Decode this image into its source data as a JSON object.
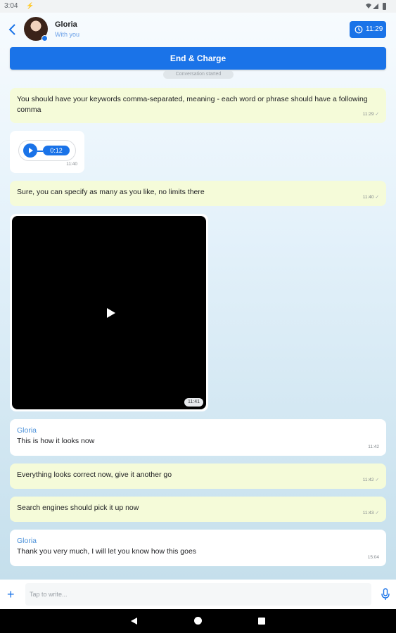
{
  "status_bar": {
    "time": "3:04",
    "bolt_icon": "⚡",
    "icons": [
      "wifi-icon",
      "signal-icon",
      "battery-icon"
    ]
  },
  "header": {
    "contact_name": "Gloria",
    "contact_subtitle": "With you",
    "timer": "11:29"
  },
  "end_button_label": "End & Charge",
  "conversation_started": "Conversation started",
  "messages": [
    {
      "type": "outgoing",
      "text": "You should have your keywords comma-separated, meaning - each word or phrase should have a following comma",
      "time": "11:29",
      "check": "✓"
    },
    {
      "type": "voice",
      "duration": "0:12",
      "time": "11:40"
    },
    {
      "type": "outgoing",
      "text": "Sure, you can specify as many as you like, no limits there",
      "time": "11:40",
      "check": "✓"
    },
    {
      "type": "video",
      "time": "11:41"
    },
    {
      "type": "incoming",
      "sender": "Gloria",
      "text": "This is how it looks now",
      "time": "11:42"
    },
    {
      "type": "outgoing",
      "text": "Everything looks correct now, give it another go",
      "time": "11:42",
      "check": "✓"
    },
    {
      "type": "outgoing",
      "text": "Search engines should pick it up now",
      "time": "11:43",
      "check": "✓"
    },
    {
      "type": "incoming",
      "sender": "Gloria",
      "text": "Thank you very much, I will let you know how this goes",
      "time": "15:04"
    }
  ],
  "composer": {
    "placeholder": "Tap to write...",
    "value": ""
  },
  "colors": {
    "accent": "#1a73e8",
    "outgoing_bubble": "#f5fbd9",
    "incoming_bubble": "#ffffff",
    "sender_name": "#4a90d9"
  }
}
